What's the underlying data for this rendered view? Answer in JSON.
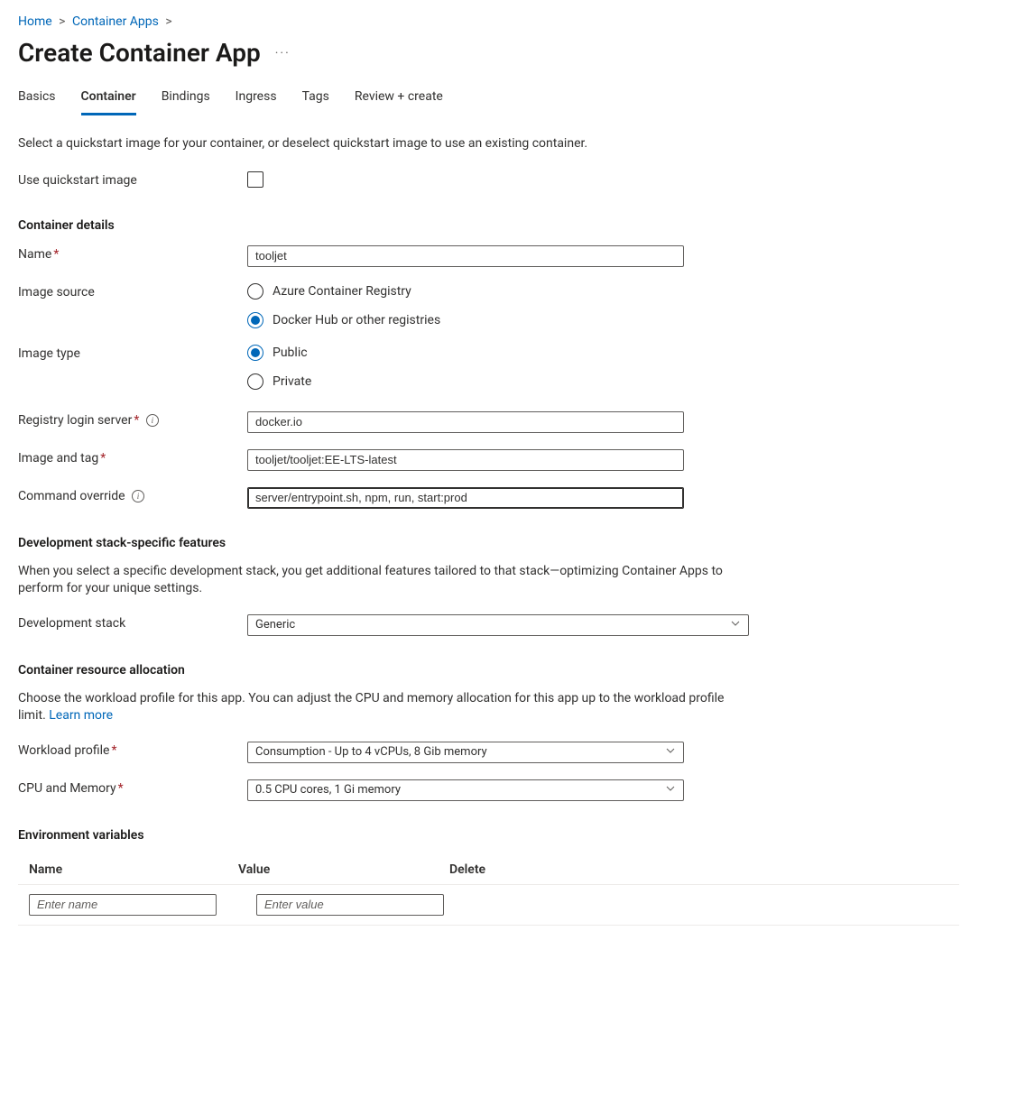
{
  "breadcrumb": {
    "home": "Home",
    "containerApps": "Container Apps"
  },
  "pageTitle": "Create Container App",
  "moreLabel": "···",
  "tabs": {
    "basics": "Basics",
    "container": "Container",
    "bindings": "Bindings",
    "ingress": "Ingress",
    "tags": "Tags",
    "review": "Review + create"
  },
  "intro": "Select a quickstart image for your container, or deselect quickstart image to use an existing container.",
  "labels": {
    "useQuickstart": "Use quickstart image",
    "containerDetails": "Container details",
    "name": "Name",
    "imageSource": "Image source",
    "imageType": "Image type",
    "registryLoginServer": "Registry login server",
    "imageAndTag": "Image and tag",
    "commandOverride": "Command override",
    "devStackHeading": "Development stack-specific features",
    "devStackDesc": "When you select a specific development stack, you get additional features tailored to that stack—optimizing Container Apps to perform for your unique settings.",
    "developmentStack": "Development stack",
    "resourceAllocHeading": "Container resource allocation",
    "resourceAllocDesc": "Choose the workload profile for this app. You can adjust the CPU and memory allocation for this app up to the workload profile limit. ",
    "learnMore": "Learn more",
    "workloadProfile": "Workload profile",
    "cpuMemory": "CPU and Memory",
    "envVarsHeading": "Environment variables",
    "envNameHeader": "Name",
    "envValueHeader": "Value",
    "envDeleteHeader": "Delete",
    "envNamePlaceholder": "Enter name",
    "envValuePlaceholder": "Enter value"
  },
  "values": {
    "name": "tooljet",
    "imageSourceAcr": "Azure Container Registry",
    "imageSourceDocker": "Docker Hub or other registries",
    "imageTypePublic": "Public",
    "imageTypePrivate": "Private",
    "registryLoginServer": "docker.io",
    "imageAndTag": "tooljet/tooljet:EE-LTS-latest",
    "commandOverride": "server/entrypoint.sh, npm, run, start:prod",
    "developmentStack": "Generic",
    "workloadProfile": "Consumption - Up to 4 vCPUs, 8 Gib memory",
    "cpuMemory": "0.5 CPU cores, 1 Gi memory"
  }
}
